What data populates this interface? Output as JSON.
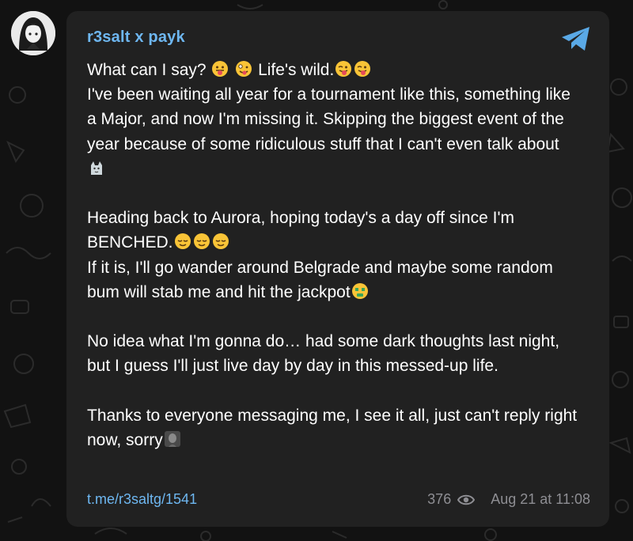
{
  "channel": {
    "author": "r3salt x payk",
    "avatar_icon": "anime-girl-avatar-icon"
  },
  "post": {
    "intro": "What can I say? ",
    "intro_b": " Life's wild.",
    "line2": "\nI've been waiting all year for a tournament like this, something like a Major, and now I'm missing it. Skipping the biggest event of the year because of some ridiculous stuff that I can't even talk about",
    "para2": "\n\nHeading back to Aurora, hoping today's a day off since I'm BENCHED.",
    "para2b": "\nIf it is, I'll go wander around Belgrade and maybe some random bum will stab me and hit the jackpot",
    "para3": "\n\nNo idea what I'm gonna do… had some dark thoughts last night, but I guess I'll just live day by day in this messed-up life.",
    "para4": "\n\nThanks to everyone messaging me, I see it all, just can't reply right now, sorry",
    "emoji": {
      "tongue": "face-with-tongue-emoji",
      "zany": "zany-face-emoji",
      "wink_tongue": "winking-face-with-tongue-emoji",
      "cat": "cat-sticker-emoji",
      "relieved": "relieved-face-emoji",
      "money": "money-mouth-face-emoji",
      "sad_photo": "sad-face-photo-emoji"
    }
  },
  "footer": {
    "link": "t.me/r3saltg/1541",
    "views": "376",
    "date": "Aug 21 at 11:08"
  },
  "colors": {
    "accent": "#6eb7f1",
    "bubble": "#212121",
    "background": "#121212",
    "meta": "#8e8e93"
  }
}
